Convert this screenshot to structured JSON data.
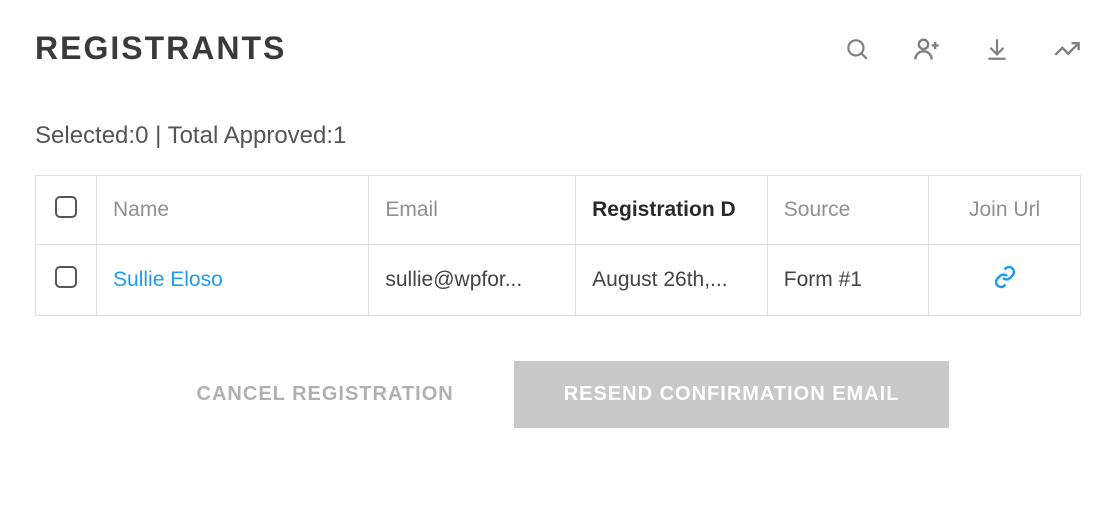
{
  "header": {
    "title": "REGISTRANTS"
  },
  "stats": {
    "selected_label": "Selected:",
    "selected_count": "0",
    "separator": " | ",
    "total_approved_label": "Total Approved:",
    "total_approved_count": "1"
  },
  "table": {
    "columns": {
      "name": "Name",
      "email": "Email",
      "registration_date": "Registration D",
      "source": "Source",
      "join_url": "Join Url"
    },
    "rows": [
      {
        "name": "Sullie Eloso",
        "email": "sullie@wpfor...",
        "registration_date": "August 26th,...",
        "source": "Form #1"
      }
    ]
  },
  "buttons": {
    "cancel_registration": "CANCEL REGISTRATION",
    "resend_confirmation": "RESEND CONFIRMATION EMAIL"
  }
}
